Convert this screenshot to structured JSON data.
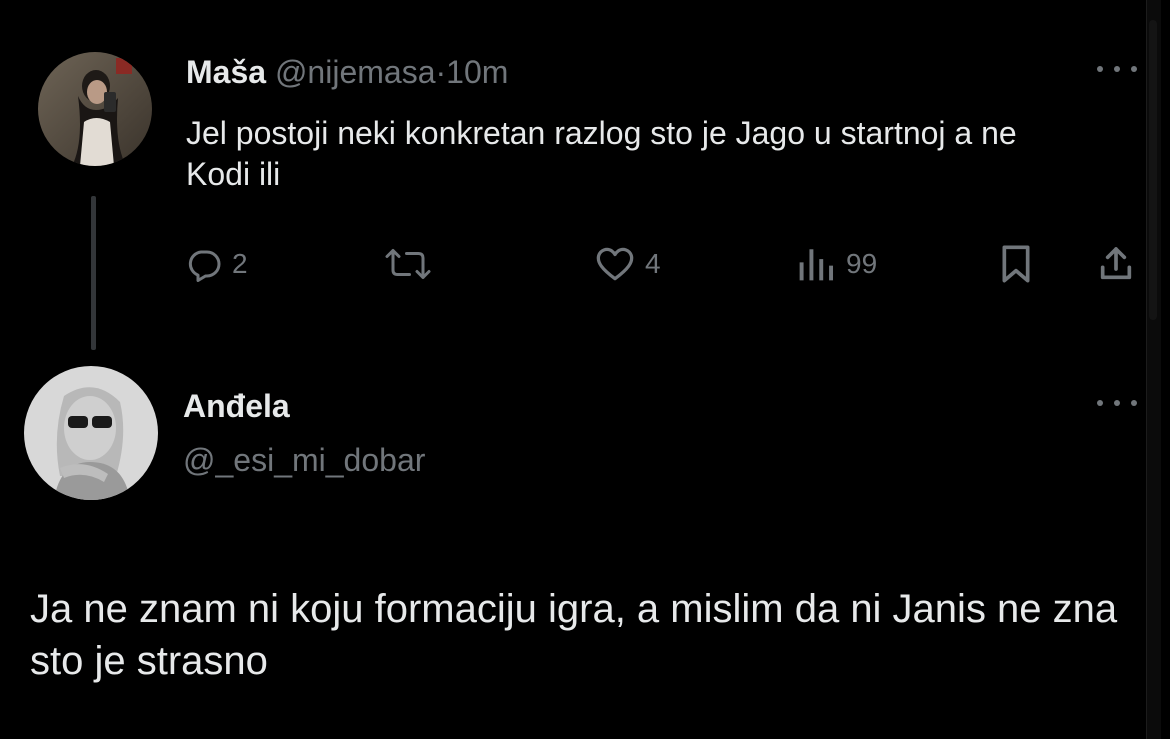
{
  "tweet1": {
    "author_name": "Maša",
    "handle": "@nijemasa",
    "separator": "·",
    "time": "10m",
    "text": "Jel postoji neki konkretan razlog sto je Jago u startnoj a ne Kodi ili",
    "actions": {
      "reply_icon": "reply-icon",
      "reply_count": "2",
      "retweet_icon": "retweet-icon",
      "like_icon": "heart-icon",
      "like_count": "4",
      "views_icon": "views-icon",
      "views_count": "99",
      "bookmark_icon": "bookmark-icon",
      "share_icon": "share-icon"
    }
  },
  "tweet2": {
    "author_name": "Anđela",
    "handle": "@_esi_mi_dobar",
    "text": "Ja ne znam ni koju formaciju igra, a mislim da ni Janis ne zna sto je strasno"
  },
  "colors": {
    "background": "#000000",
    "primary_text": "#e7e9ea",
    "secondary_text": "#71767b",
    "thread_line": "#333639"
  }
}
